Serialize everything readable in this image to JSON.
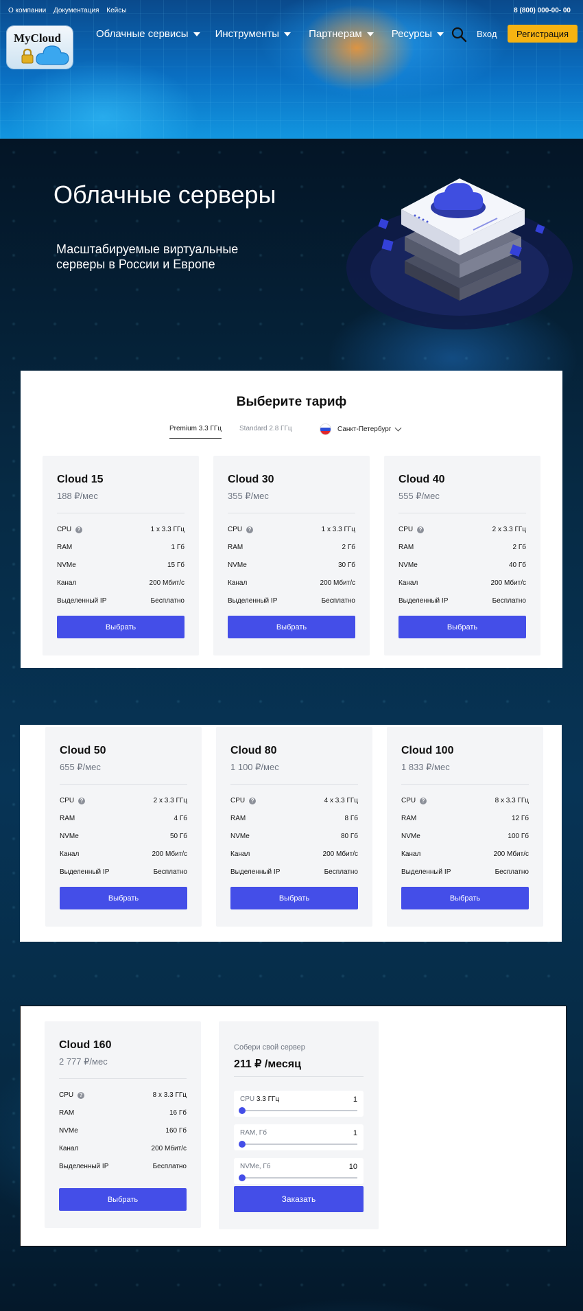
{
  "colors": {
    "accent": "#444ee8",
    "register_bg": "#f6b312",
    "card_bg": "#f4f5f7"
  },
  "topbar": {
    "links": [
      "О компании",
      "Документация",
      "Кейсы"
    ],
    "phone": "8 (800) 000-00- 00"
  },
  "logo": {
    "text": "MyCloud"
  },
  "nav": {
    "items": [
      "Облачные сервисы",
      "Инструменты",
      "Партнерам",
      "Ресурсы"
    ],
    "login": "Вход",
    "register": "Регистрация"
  },
  "hero": {
    "title": "Облачные серверы",
    "subtitle": "Масштабируемые виртуальные серверы в России и Европе"
  },
  "pricing": {
    "title": "Выберите тариф",
    "tabs": [
      "Premium 3.3 ГГц",
      "Standard 2.8 ГГц"
    ],
    "active_tab": "Premium 3.3 ГГц",
    "location": "Санкт-Петербург",
    "spec_labels": {
      "cpu": "CPU",
      "ram": "RAM",
      "nvme": "NVMe",
      "channel": "Канал",
      "ip": "Выделенный IP"
    },
    "select_label": "Выбрать",
    "plans": [
      {
        "name": "Cloud 15",
        "price": "188 ₽/мес",
        "cpu": "1 x 3.3 ГГц",
        "ram": "1 Гб",
        "nvme": "15 Гб",
        "channel": "200 Мбит/с",
        "ip": "Бесплатно"
      },
      {
        "name": "Cloud 30",
        "price": "355 ₽/мес",
        "cpu": "1 x 3.3 ГГц",
        "ram": "2 Гб",
        "nvme": "30 Гб",
        "channel": "200 Мбит/с",
        "ip": "Бесплатно"
      },
      {
        "name": "Cloud 40",
        "price": "555 ₽/мес",
        "cpu": "2 x 3.3 ГГц",
        "ram": "2 Гб",
        "nvme": "40 Гб",
        "channel": "200 Мбит/с",
        "ip": "Бесплатно"
      },
      {
        "name": "Cloud 50",
        "price": "655 ₽/мес",
        "cpu": "2 x 3.3 ГГц",
        "ram": "4 Гб",
        "nvme": "50 Гб",
        "channel": "200 Мбит/с",
        "ip": "Бесплатно"
      },
      {
        "name": "Cloud 80",
        "price": "1 100 ₽/мес",
        "cpu": "4 x 3.3 ГГц",
        "ram": "8 Гб",
        "nvme": "80 Гб",
        "channel": "200 Мбит/с",
        "ip": "Бесплатно"
      },
      {
        "name": "Cloud 100",
        "price": "1 833 ₽/мес",
        "cpu": "8 x 3.3 ГГц",
        "ram": "12 Гб",
        "nvme": "100 Гб",
        "channel": "200 Мбит/с",
        "ip": "Бесплатно"
      },
      {
        "name": "Cloud 160",
        "price": "2 777 ₽/мес",
        "cpu": "8 x 3.3 ГГц",
        "ram": "16 Гб",
        "nvme": "160 Гб",
        "channel": "200 Мбит/с",
        "ip": "Бесплатно"
      }
    ]
  },
  "builder": {
    "label": "Собери свой сервер",
    "price": "211 ₽ /месяц",
    "sliders": [
      {
        "label": "CPU",
        "label_suffix": "3.3 ГГц",
        "value": "1",
        "level": 0
      },
      {
        "label": "RAM, Гб",
        "label_suffix": "",
        "value": "1",
        "level": 0
      },
      {
        "label": "NVMe, Гб",
        "label_suffix": "",
        "value": "10",
        "level": 0
      }
    ],
    "order_label": "Заказать"
  }
}
